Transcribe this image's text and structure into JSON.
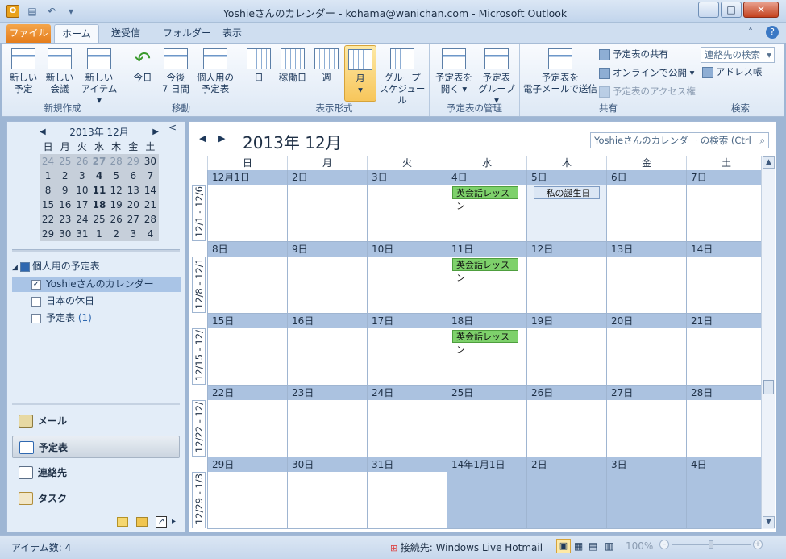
{
  "window": {
    "title": "Yoshieさんのカレンダー - kohama@wanichan.com  -  Microsoft Outlook",
    "app_icon": "O"
  },
  "tabs": [
    "ファイル",
    "ホーム",
    "送受信",
    "フォルダー",
    "表示"
  ],
  "ribbon": {
    "new_group": {
      "label": "新規作成",
      "buttons": [
        "新しい\n予定",
        "新しい\n会議",
        "新しい\nアイテム ▾"
      ]
    },
    "move_group": {
      "label": "移動",
      "buttons": [
        "今日",
        "今後\n7 日間",
        "個人用の\n予定表"
      ]
    },
    "view_group": {
      "label": "表示形式",
      "buttons": [
        "日",
        "稼働日",
        "週",
        "月\n▾",
        "グループ\nスケジュール"
      ]
    },
    "manage_group": {
      "label": "予定表の管理",
      "buttons": [
        "予定表を\n開く ▾",
        "予定表\nグループ ▾"
      ]
    },
    "share_group": {
      "label": "共有",
      "send_email": "予定表を\n電子メールで送信",
      "share": "予定表の共有",
      "publish": "オンラインで公開 ▾",
      "access": "予定表のアクセス権"
    },
    "find_group": {
      "label": "検索",
      "search_contact": "連絡先の検索",
      "address_book": "アドレス帳"
    }
  },
  "minical": {
    "title": "2013年 12月",
    "dow": [
      "日",
      "月",
      "火",
      "水",
      "木",
      "金",
      "土"
    ],
    "weeks": [
      [
        "24",
        "25",
        "26",
        "27",
        "28",
        "29",
        "30"
      ],
      [
        "1",
        "2",
        "3",
        "4",
        "5",
        "6",
        "7"
      ],
      [
        "8",
        "9",
        "10",
        "11",
        "12",
        "13",
        "14"
      ],
      [
        "15",
        "16",
        "17",
        "18",
        "19",
        "20",
        "21"
      ],
      [
        "22",
        "23",
        "24",
        "25",
        "26",
        "27",
        "28"
      ],
      [
        "29",
        "30",
        "31",
        "1",
        "2",
        "3",
        "4"
      ]
    ]
  },
  "tree": {
    "group": "個人用の予定表",
    "items": [
      {
        "label": "Yoshieさんのカレンダー",
        "checked": true
      },
      {
        "label": "日本の休日",
        "checked": false
      },
      {
        "label": "予定表",
        "count": "(1)",
        "checked": false
      }
    ]
  },
  "nav": {
    "mail": "メール",
    "calendar": "予定表",
    "contacts": "連絡先",
    "tasks": "タスク"
  },
  "calendar": {
    "title": "2013年 12月",
    "search_placeholder": "Yoshieさんのカレンダー の検索 (Ctrl+E)",
    "dow": [
      "日",
      "月",
      "火",
      "水",
      "木",
      "金",
      "土"
    ],
    "weeks": [
      {
        "label": "12/1 - 12/6",
        "days": [
          "12月1日",
          "2日",
          "3日",
          "4日",
          "5日",
          "6日",
          "7日"
        ]
      },
      {
        "label": "12/8 - 12/1",
        "days": [
          "8日",
          "9日",
          "10日",
          "11日",
          "12日",
          "13日",
          "14日"
        ]
      },
      {
        "label": "12/15 - 12/",
        "days": [
          "15日",
          "16日",
          "17日",
          "18日",
          "19日",
          "20日",
          "21日"
        ]
      },
      {
        "label": "12/22 - 12/",
        "days": [
          "22日",
          "23日",
          "24日",
          "25日",
          "26日",
          "27日",
          "28日"
        ]
      },
      {
        "label": "12/29 - 1/3",
        "days": [
          "29日",
          "30日",
          "31日",
          "14年1月1日",
          "2日",
          "3日",
          "4日"
        ]
      }
    ],
    "events": {
      "english": "英会話レッスン",
      "birthday": "私の誕生日"
    }
  },
  "status": {
    "items": "アイテム数: 4",
    "connection": "接続先: Windows Live Hotmail",
    "zoom": "100%"
  }
}
